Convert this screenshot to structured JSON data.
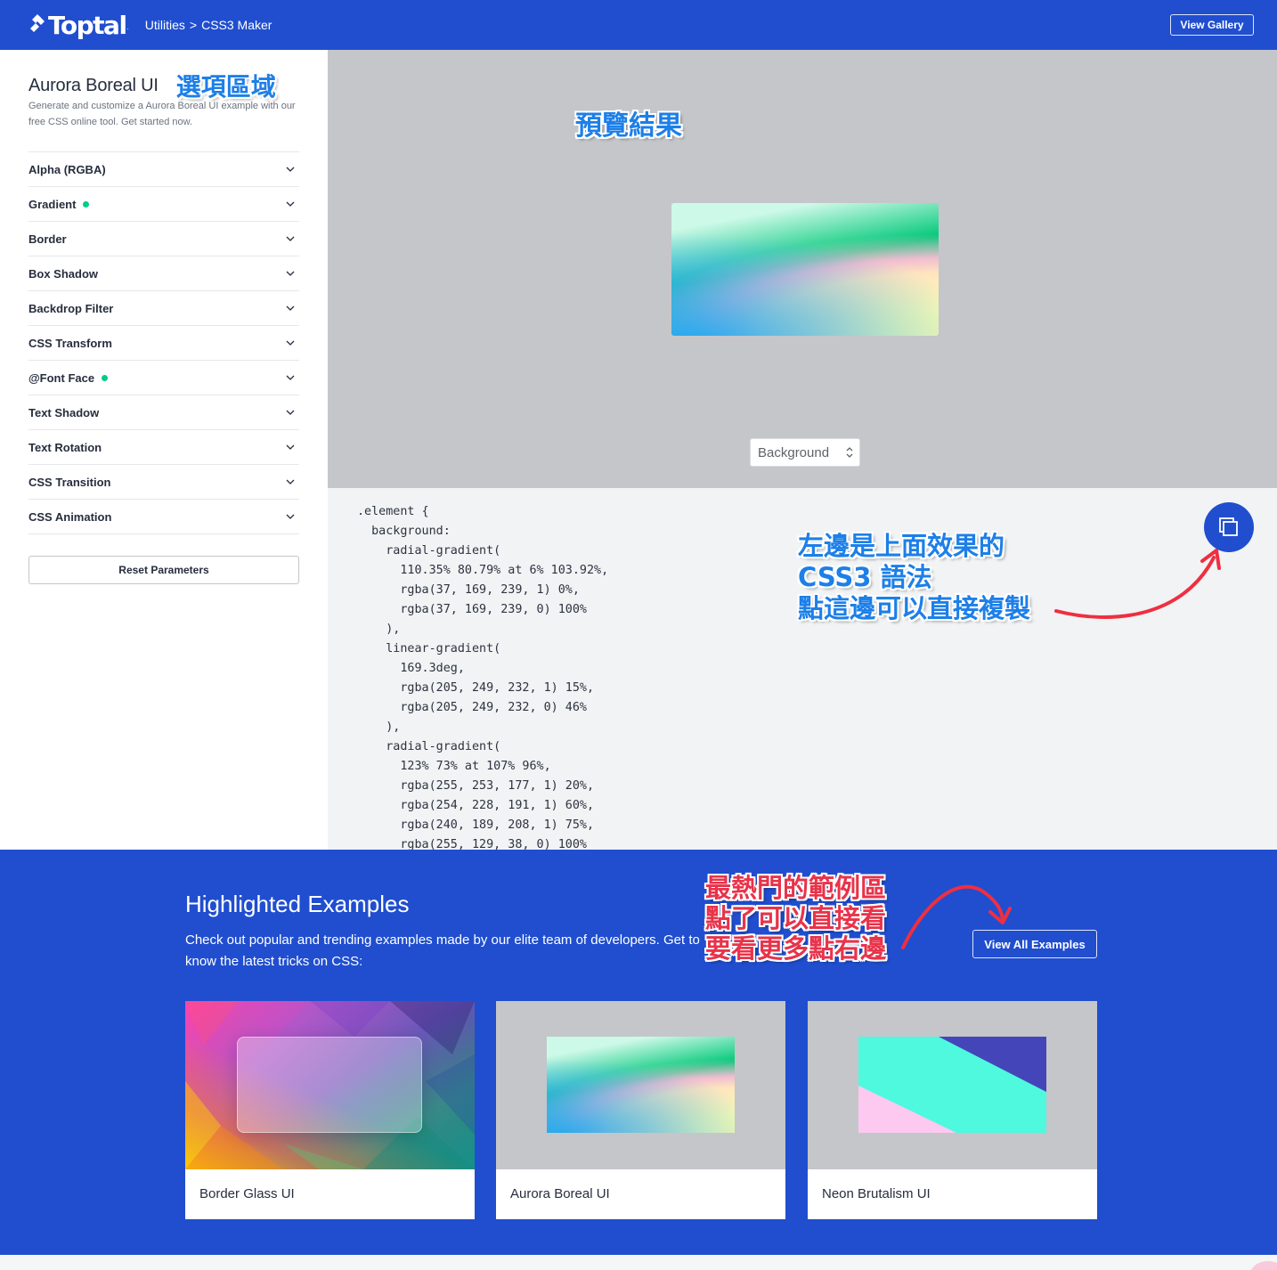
{
  "header": {
    "logo_text": "Toptal",
    "logo_tm": ".",
    "breadcrumb_parent": "Utilities",
    "breadcrumb_sep": ">",
    "breadcrumb_current": "CSS3 Maker",
    "view_gallery": "View Gallery",
    "brand_color": "#204ecf"
  },
  "sidebar": {
    "title": "Aurora Boreal UI",
    "annotation": "選項區域",
    "description": "Generate and customize a Aurora Boreal UI example with our free CSS online tool. Get started now.",
    "items": [
      {
        "label": "Alpha (RGBA)",
        "active": false
      },
      {
        "label": "Gradient",
        "active": true
      },
      {
        "label": "Border",
        "active": false
      },
      {
        "label": "Box Shadow",
        "active": false
      },
      {
        "label": "Backdrop Filter",
        "active": false
      },
      {
        "label": "CSS Transform",
        "active": false
      },
      {
        "label": "@Font Face",
        "active": true
      },
      {
        "label": "Text Shadow",
        "active": false
      },
      {
        "label": "Text Rotation",
        "active": false
      },
      {
        "label": "CSS Transition",
        "active": false
      },
      {
        "label": "CSS Animation",
        "active": false
      }
    ],
    "reset_label": "Reset Parameters",
    "active_dot_color": "#00cc83"
  },
  "preview": {
    "annotation": "預覽結果",
    "select_value": "Background"
  },
  "code": {
    "text": ".element {\n  background:\n    radial-gradient(\n      110.35% 80.79% at 6% 103.92%,\n      rgba(37, 169, 239, 1) 0%,\n      rgba(37, 169, 239, 0) 100%\n    ),\n    linear-gradient(\n      169.3deg,\n      rgba(205, 249, 232, 1) 15%,\n      rgba(205, 249, 232, 0) 46%\n    ),\n    radial-gradient(\n      123% 73% at 107% 96%,\n      rgba(255, 253, 177, 1) 20%,\n      rgba(254, 228, 191, 1) 60%,\n      rgba(240, 189, 208, 1) 75%,\n      rgba(255, 129, 38, 0) 100%",
    "annotation_line1": "左邊是上面效果的",
    "annotation_line2": "CSS3 語法",
    "annotation_line3": "點這邊可以直接複製",
    "copy_icon": "copy-icon"
  },
  "highlighted": {
    "title": "Highlighted Examples",
    "description": "Check out popular and trending examples made by our elite team of developers. Get to know the latest tricks on CSS:",
    "view_all": "View All Examples",
    "annotation_line1": "最熱門的範例區",
    "annotation_line2": "點了可以直接看",
    "annotation_line3": "要看更多點右邊",
    "cards": [
      {
        "label": "Border Glass UI"
      },
      {
        "label": "Aurora Boreal UI"
      },
      {
        "label": "Neon Brutalism UI"
      }
    ]
  }
}
